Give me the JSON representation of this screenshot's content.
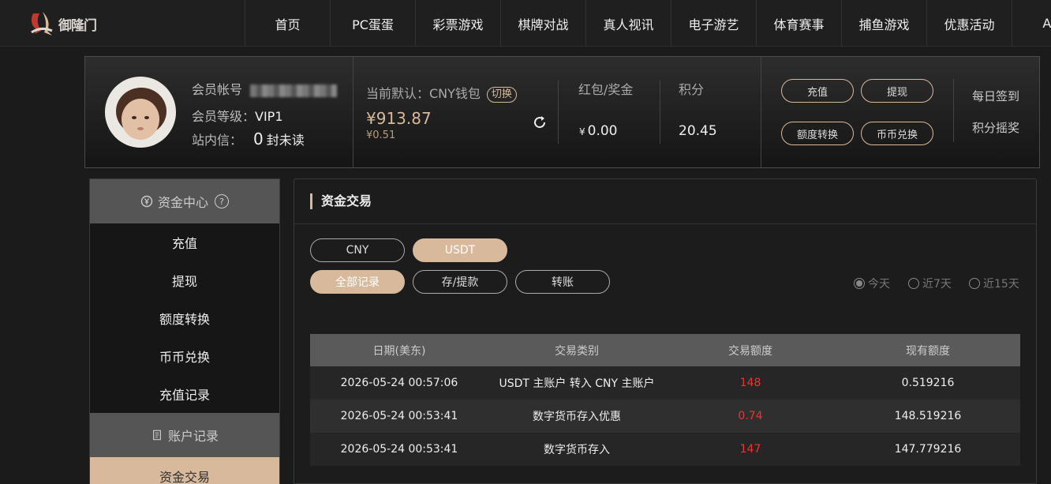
{
  "brand": {
    "name": "御隆门"
  },
  "nav": [
    "首页",
    "PC蛋蛋",
    "彩票游戏",
    "棋牌对战",
    "真人视讯",
    "电子游艺",
    "体育赛事",
    "捕鱼游戏",
    "优惠活动",
    "APP"
  ],
  "user": {
    "account_label": "会员帐号",
    "level_label": "会员等级：",
    "level_value": "VIP1",
    "inbox_label": "站内信：",
    "inbox_count": "0",
    "inbox_suffix": "封未读"
  },
  "wallet": {
    "current_label": "当前默认：CNY钱包",
    "switch_label": "切换",
    "balance": "¥913.87",
    "sub_balance": "¥0.51"
  },
  "stats": {
    "bonus_label": "红包/奖金",
    "bonus_currency": "¥",
    "bonus_value": "0.00",
    "points_label": "积分",
    "points_value": "20.45"
  },
  "actions": {
    "deposit": "充值",
    "withdraw": "提现",
    "transfer": "额度转换",
    "exchange": "币币兑换",
    "checkin": "每日签到",
    "lottery": "积分摇奖"
  },
  "sidebar": {
    "section1": "资金中心",
    "section1_help": "?",
    "items1": [
      "充值",
      "提现",
      "额度转换",
      "币币兑换",
      "充值记录"
    ],
    "section2": "账户记录",
    "items2": [
      "资金交易"
    ]
  },
  "main": {
    "title": "资金交易",
    "currency_tabs": [
      "CNY",
      "USDT"
    ],
    "active_currency": "USDT",
    "type_tabs": [
      "全部记录",
      "存/提款",
      "转账"
    ],
    "active_type": "全部记录",
    "ranges": [
      "今天",
      "近7天",
      "近15天"
    ],
    "active_range": "今天"
  },
  "table": {
    "headers": [
      "日期(美东)",
      "交易类别",
      "交易额度",
      "现有额度"
    ],
    "rows": [
      [
        "2026-05-24 00:57:06",
        "USDT 主账户 转入 CNY 主账户",
        "148",
        "0.519216"
      ],
      [
        "2026-05-24 00:53:41",
        "数字货币存入优惠",
        "0.74",
        "148.519216"
      ],
      [
        "2026-05-24 00:53:41",
        "数字货币存入",
        "147",
        "147.779216"
      ]
    ]
  },
  "colors": {
    "accent": "#d9b99b",
    "negative": "#e33333"
  }
}
